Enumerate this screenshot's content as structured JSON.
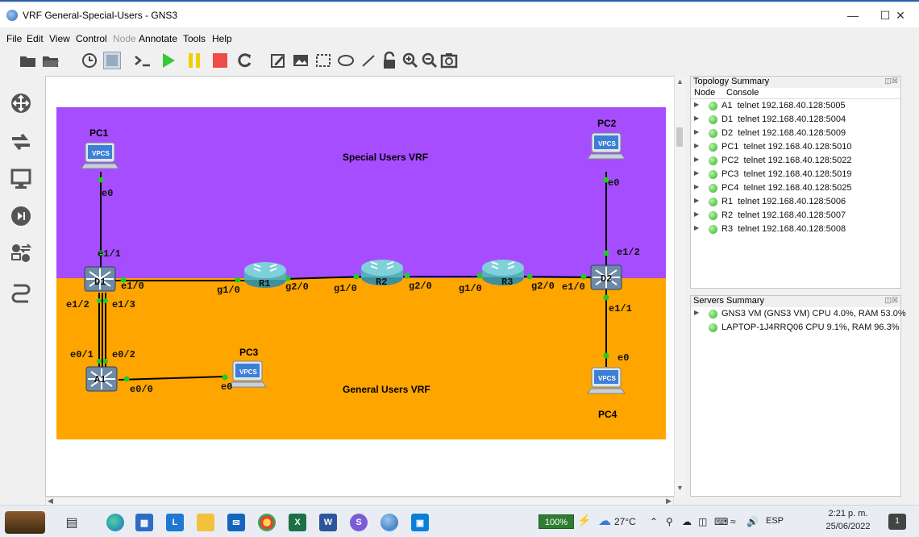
{
  "window": {
    "title": "VRF General-Special-Users - GNS3"
  },
  "menu": [
    {
      "label": "File",
      "enabled": true
    },
    {
      "label": "Edit",
      "enabled": true
    },
    {
      "label": "View",
      "enabled": true
    },
    {
      "label": "Control",
      "enabled": true
    },
    {
      "label": "Node",
      "enabled": false
    },
    {
      "label": "Annotate",
      "enabled": true
    },
    {
      "label": "Tools",
      "enabled": true
    },
    {
      "label": "Help",
      "enabled": true
    }
  ],
  "topology": {
    "zones": [
      {
        "label": "Special Users VRF",
        "color": "#a64dff"
      },
      {
        "label": "General Users VRF",
        "color": "#ffa500"
      }
    ],
    "nodes": {
      "pc1": "PC1",
      "pc2": "PC2",
      "pc3": "PC3",
      "pc4": "PC4",
      "d1": "D1",
      "d2": "D2",
      "a1": "A1",
      "r1": "R1",
      "r2": "R2",
      "r3": "R3",
      "vpcs": "VPCS"
    },
    "ports": {
      "pc1_e0": "e0",
      "d1_e1_1": "e1/1",
      "d1_e1_0": "e1/0",
      "d1_e1_2": "e1/2",
      "d1_e1_3": "e1/3",
      "a1_e0_1": "e0/1",
      "a1_e0_2": "e0/2",
      "a1_e0_0": "e0/0",
      "pc3_e0": "e0",
      "r1_g1_0": "g1/0",
      "r1_g2_0": "g2/0",
      "r2_g1_0": "g1/0",
      "r2_g2_0": "g2/0",
      "r3_g1_0": "g1/0",
      "r3_g2_0": "g2/0",
      "d2_e1_0": "e1/0",
      "d2_e1_2": "e1/2",
      "d2_e1_1": "e1/1",
      "pc2_e0": "e0",
      "pc4_e0": "e0"
    }
  },
  "topology_summary": {
    "title": "Topology Summary",
    "col_node": "Node",
    "col_console": "Console",
    "rows": [
      {
        "node": "A1",
        "console": "telnet 192.168.40.128:5005"
      },
      {
        "node": "D1",
        "console": "telnet 192.168.40.128:5004"
      },
      {
        "node": "D2",
        "console": "telnet 192.168.40.128:5009"
      },
      {
        "node": "PC1",
        "console": "telnet 192.168.40.128:5010"
      },
      {
        "node": "PC2",
        "console": "telnet 192.168.40.128:5022"
      },
      {
        "node": "PC3",
        "console": "telnet 192.168.40.128:5019"
      },
      {
        "node": "PC4",
        "console": "telnet 192.168.40.128:5025"
      },
      {
        "node": "R1",
        "console": "telnet 192.168.40.128:5006"
      },
      {
        "node": "R2",
        "console": "telnet 192.168.40.128:5007"
      },
      {
        "node": "R3",
        "console": "telnet 192.168.40.128:5008"
      }
    ]
  },
  "servers_summary": {
    "title": "Servers Summary",
    "rows": [
      {
        "text": "GNS3 VM (GNS3 VM) CPU 4.0%, RAM 53.0%"
      },
      {
        "text": "LAPTOP-1J4RRQ06 CPU 9.1%, RAM 96.3%"
      }
    ]
  },
  "taskbar": {
    "battery": "100%",
    "temperature": "27°C",
    "language": "ESP",
    "time": "2:21 p. m.",
    "date": "25/06/2022",
    "notification_count": "1"
  }
}
